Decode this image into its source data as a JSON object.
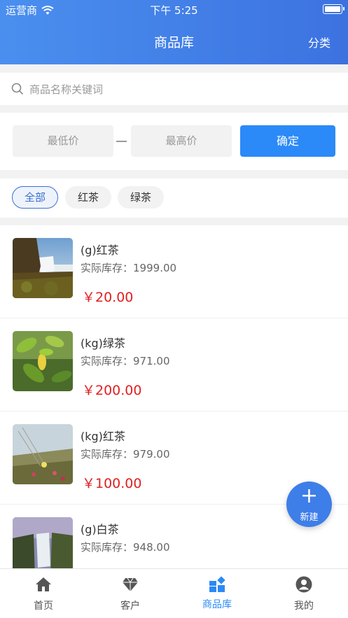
{
  "status_bar": {
    "carrier": "运营商",
    "time": "下午 5:25"
  },
  "header": {
    "title": "商品库",
    "right_action": "分类"
  },
  "search": {
    "placeholder": "商品名称关键词"
  },
  "price_filter": {
    "min_placeholder": "最低价",
    "max_placeholder": "最高价",
    "confirm_label": "确定"
  },
  "tags": [
    {
      "label": "全部",
      "active": true
    },
    {
      "label": "红茶",
      "active": false
    },
    {
      "label": "绿茶",
      "active": false
    }
  ],
  "products": [
    {
      "name": "(g)红茶",
      "stock_label": "实际库存：",
      "stock": "1999.00",
      "price": "￥20.00",
      "image": "waterfall-cliff"
    },
    {
      "name": "(kg)绿茶",
      "stock_label": "实际库存：",
      "stock": "971.00",
      "price": "￥200.00",
      "image": "green-leaves"
    },
    {
      "name": "(kg)红茶",
      "stock_label": "实际库存：",
      "stock": "979.00",
      "price": "￥100.00",
      "image": "coastal-flowers"
    },
    {
      "name": "(g)白茶",
      "stock_label": "实际库存：",
      "stock": "948.00",
      "price": "",
      "image": "waterfall-valley"
    }
  ],
  "fab": {
    "label": "新建"
  },
  "tabbar": [
    {
      "label": "首页",
      "icon": "home-icon",
      "active": false
    },
    {
      "label": "客户",
      "icon": "diamond-icon",
      "active": false
    },
    {
      "label": "商品库",
      "icon": "grid-icon",
      "active": true
    },
    {
      "label": "我的",
      "icon": "user-icon",
      "active": false
    }
  ],
  "colors": {
    "primary": "#2b8af7",
    "header_start": "#4a8fef",
    "header_end": "#3c72e0",
    "price": "#e02020"
  }
}
